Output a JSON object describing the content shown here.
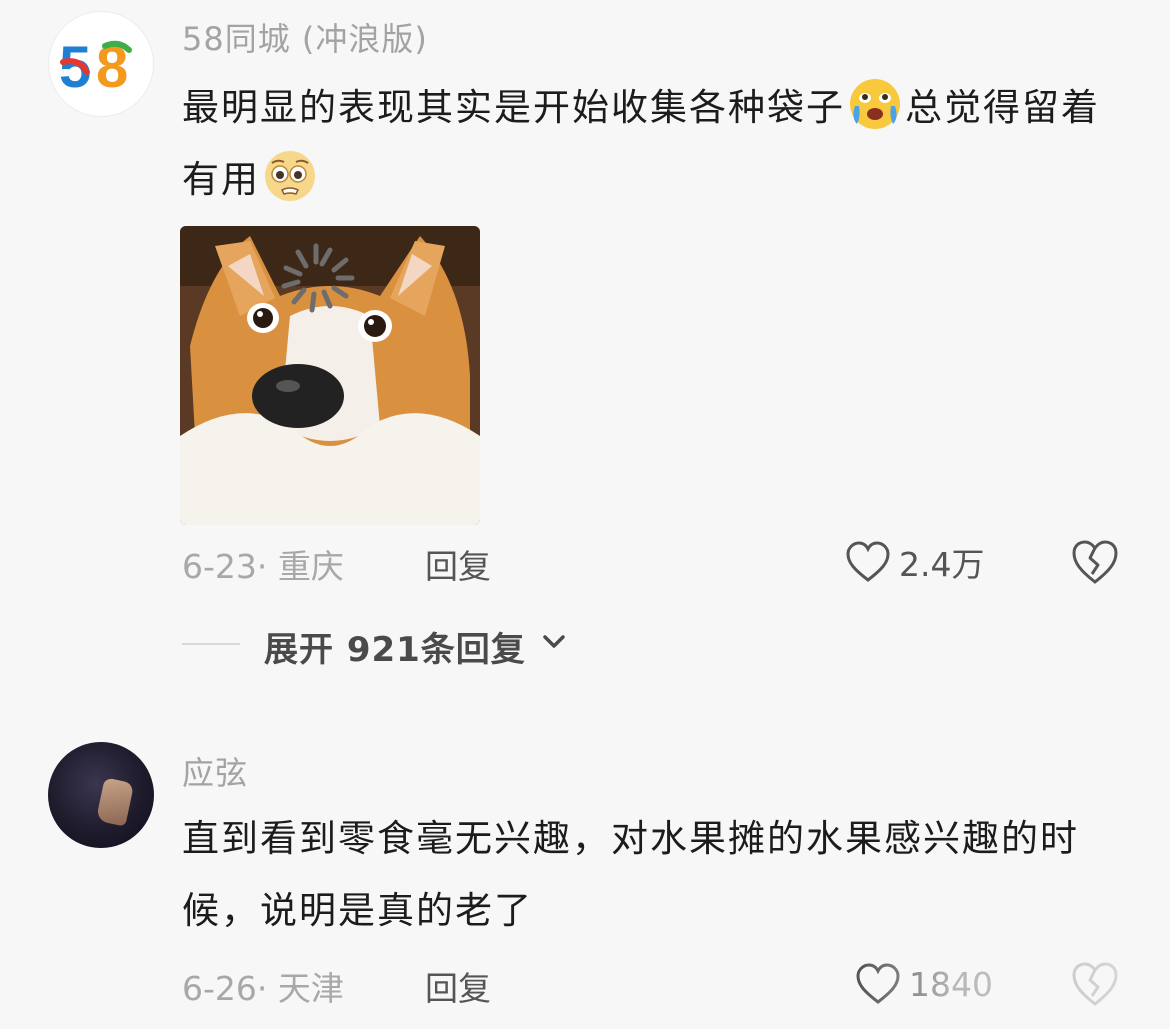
{
  "comments": [
    {
      "username": "58同城 (冲浪版)",
      "text_part1": "最明显的表现其实是开始收集各种袋子",
      "text_part2": "总觉得留着有用",
      "emoji1": "crying-laughing-emoji",
      "emoji2": "pleading-face-emoji",
      "image": "corgi-meme-image",
      "meta": "6-23· 重庆",
      "reply_label": "回复",
      "like_count": "2.4万",
      "expand_label": "展开 921条回复"
    },
    {
      "username": "应弦",
      "text": "直到看到零食毫无兴趣，对水果摊的水果感兴趣的时候，说明是真的老了",
      "meta": "6-26· 天津",
      "reply_label": "回复",
      "like_count": "1840"
    }
  ],
  "colors": {
    "background": "#f7f7f7",
    "text_primary": "#1c1c1c",
    "text_secondary": "#a8a8a8",
    "logo_5": "#e8352e",
    "logo_8": "#f39a1e",
    "logo_blue": "#1f7fd1",
    "logo_green": "#3fae49"
  }
}
